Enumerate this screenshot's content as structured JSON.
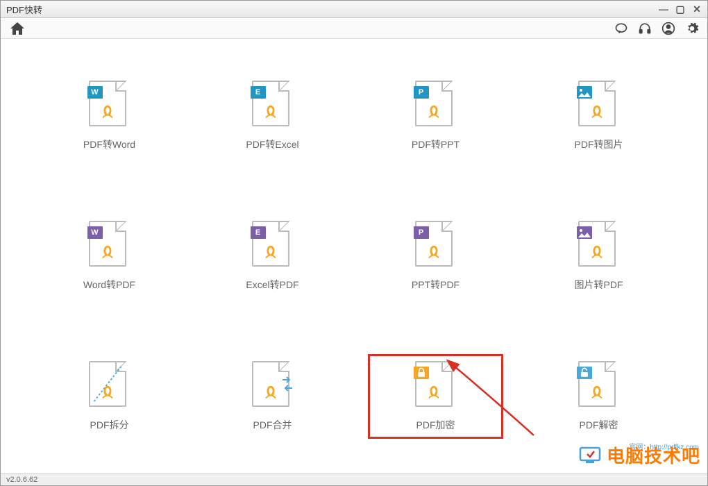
{
  "window": {
    "title": "PDF快转"
  },
  "tiles": [
    {
      "label": "PDF转Word",
      "badge": "W",
      "badgeColor": "blue",
      "type": "to-format"
    },
    {
      "label": "PDF转Excel",
      "badge": "E",
      "badgeColor": "blue",
      "type": "to-format"
    },
    {
      "label": "PDF转PPT",
      "badge": "P",
      "badgeColor": "blue",
      "type": "to-format"
    },
    {
      "label": "PDF转图片",
      "badge": "img",
      "badgeColor": "blue",
      "type": "to-image"
    },
    {
      "label": "Word转PDF",
      "badge": "W",
      "badgeColor": "purple",
      "type": "from-format"
    },
    {
      "label": "Excel转PDF",
      "badge": "E",
      "badgeColor": "purple",
      "type": "from-format"
    },
    {
      "label": "PPT转PDF",
      "badge": "P",
      "badgeColor": "purple",
      "type": "from-format"
    },
    {
      "label": "图片转PDF",
      "badge": "img",
      "badgeColor": "purple",
      "type": "from-image"
    },
    {
      "label": "PDF拆分",
      "badge": "",
      "badgeColor": "",
      "type": "split"
    },
    {
      "label": "PDF合并",
      "badge": "",
      "badgeColor": "",
      "type": "merge"
    },
    {
      "label": "PDF加密",
      "badge": "lock",
      "badgeColor": "orange",
      "type": "encrypt",
      "highlighted": true
    },
    {
      "label": "PDF解密",
      "badge": "unlock",
      "badgeColor": "cyan",
      "type": "decrypt"
    }
  ],
  "statusbar": {
    "version": "v2.0.6.62"
  },
  "watermark": {
    "text": "电脑技术吧",
    "url": "官网：http://pdfkz.com"
  }
}
